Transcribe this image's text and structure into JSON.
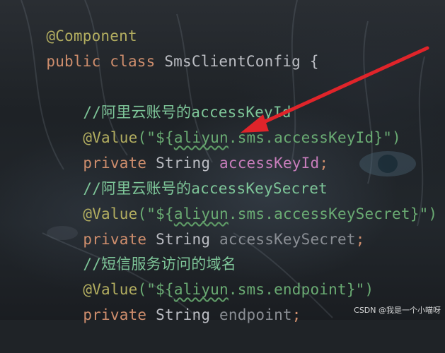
{
  "code": {
    "line1": {
      "annotation": "@Component"
    },
    "line2": {
      "kw_public": "public",
      "kw_class": "class",
      "class_name": "SmsClientConfig",
      "brace": "{"
    },
    "line4": {
      "comment": "//阿里云账号的accessKeyId"
    },
    "line5": {
      "annotation": "@Value",
      "paren_open": "(\"${",
      "squiggle": "aliyun",
      "rest": ".sms.accessKeyId}\")"
    },
    "line6": {
      "kw": "private",
      "type": "String",
      "field": "accessKeyId",
      "semi": ";"
    },
    "line7": {
      "comment": "//阿里云账号的accessKeySecret"
    },
    "line8": {
      "annotation": "@Value",
      "paren_open": "(\"${",
      "squiggle": "aliyun",
      "rest": ".sms.accessKeySecret}\")"
    },
    "line9": {
      "kw": "private",
      "type": "String",
      "field": "accessKeySecret",
      "semi": ";"
    },
    "line10": {
      "comment": "//短信服务访问的域名"
    },
    "line11": {
      "annotation": "@Value",
      "paren_open": "(\"${",
      "squiggle": "aliyun",
      "rest": ".sms.endpoint}\")"
    },
    "line12": {
      "kw": "private",
      "type": "String",
      "field": "endpoint",
      "semi": ";"
    }
  },
  "colors": {
    "annotation": "#b3ae60",
    "keyword": "#cf8e6d",
    "field": "#c77dbb",
    "comment": "#7ec699",
    "string": "#6aab73",
    "arrow": "#e0242a"
  },
  "watermark": "CSDN @我是一个小喵呀",
  "icons": [
    "red-arrow-icon"
  ]
}
